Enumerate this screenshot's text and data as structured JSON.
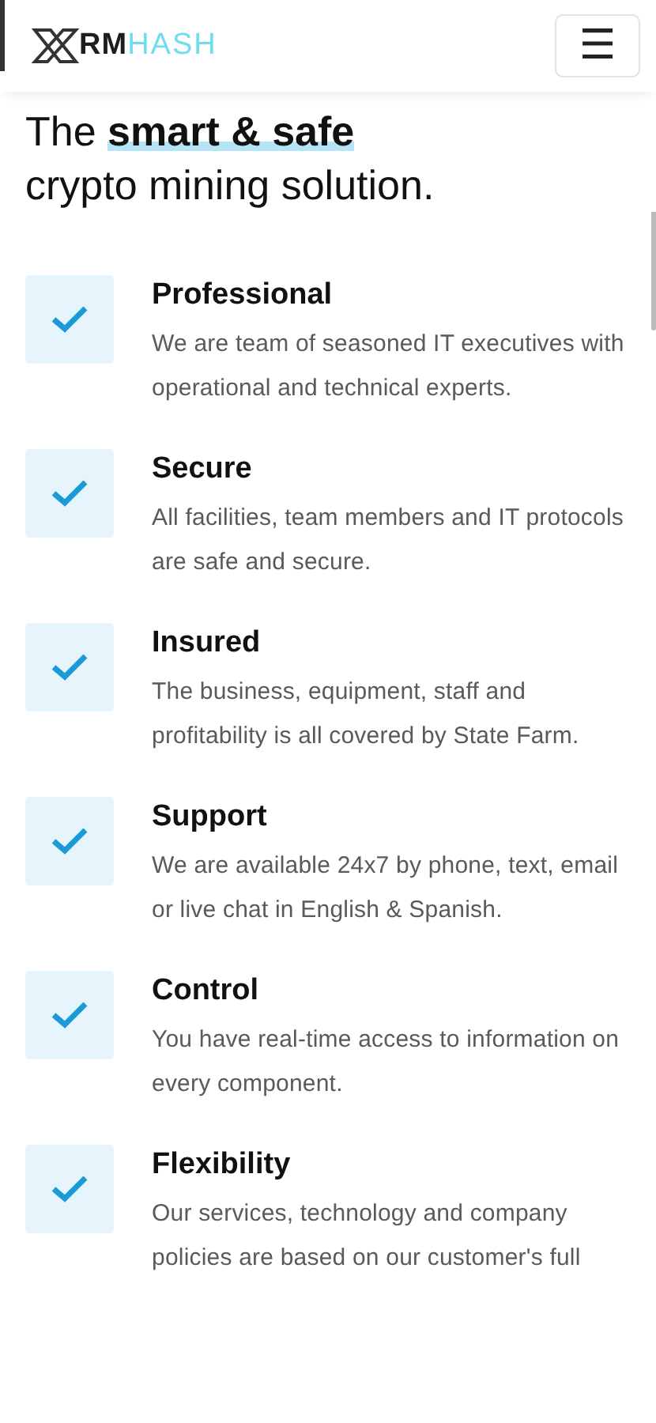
{
  "header": {
    "logo": {
      "prefix": "RM",
      "suffix": "HASH"
    },
    "menu_button": "☰"
  },
  "heading": "The **smart & safe**\ncrypto mining solution.",
  "features": [
    {
      "title": "Professional",
      "text": "We are team of seasoned IT executives with operational and technical experts.",
      "checked": true
    },
    {
      "title": "Secure",
      "text": "All facilities, team members and IT protocols are safe and secure.",
      "checked": true
    },
    {
      "title": "Insured",
      "text": "The business, equipment, staff and profitability is all covered by State Farm.",
      "checked": true
    },
    {
      "title": "Support",
      "text": "We are available 24x7 by phone, text, email or live chat in English & Spanish.",
      "checked": true
    },
    {
      "title": "Control",
      "text": "You have real-time access to information on every component.",
      "checked": true
    },
    {
      "title": "Flexibility",
      "text": "Our services, technology and company policies are based on our customer's full",
      "checked": true
    }
  ]
}
